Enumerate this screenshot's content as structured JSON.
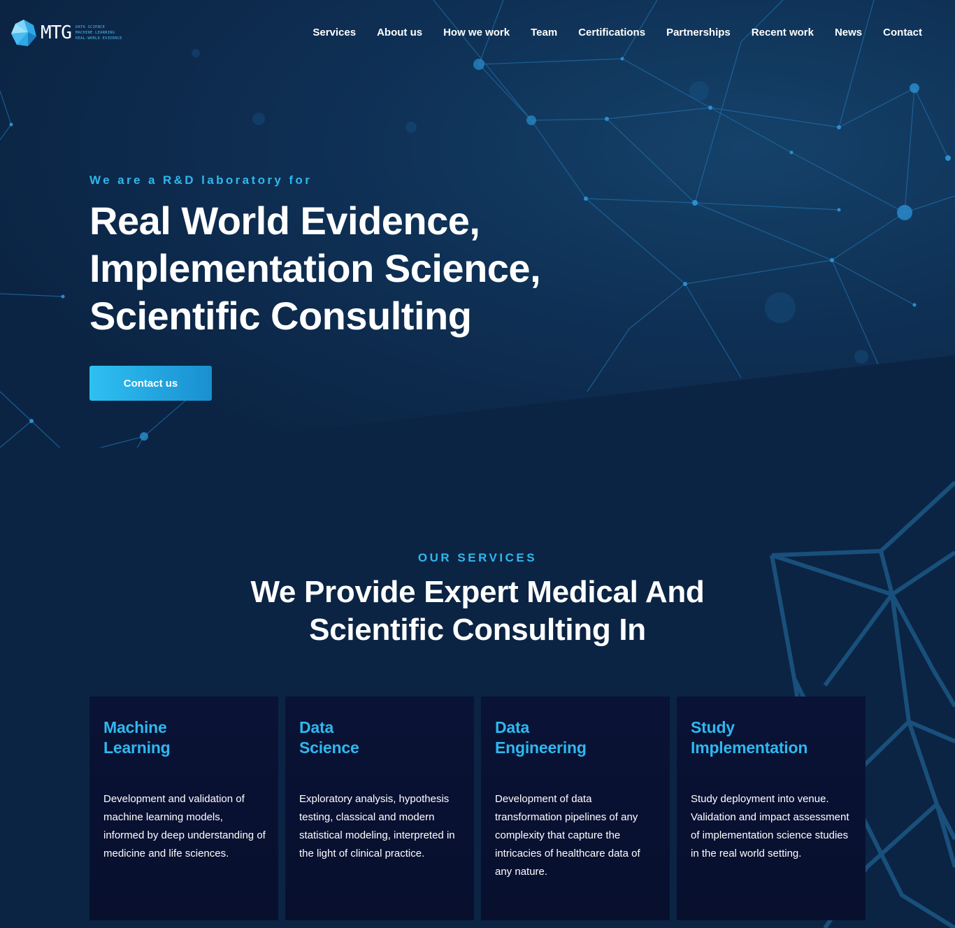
{
  "brand": {
    "name": "MTG",
    "tagline": [
      "DATA SCIENCE",
      "MACHINE LEARNING",
      "REAL-WORLD EVIDENCE"
    ]
  },
  "nav": {
    "items": [
      {
        "label": "Services"
      },
      {
        "label": "About us"
      },
      {
        "label": "How we work"
      },
      {
        "label": "Team"
      },
      {
        "label": "Certifications"
      },
      {
        "label": "Partnerships"
      },
      {
        "label": "Recent work"
      },
      {
        "label": "News"
      },
      {
        "label": "Contact"
      }
    ]
  },
  "hero": {
    "kicker": "We are a R&D laboratory for",
    "title_lines": [
      "Real World Evidence,",
      "Implementation Science,",
      "Scientific Consulting"
    ],
    "cta_label": "Contact us"
  },
  "services": {
    "kicker": "OUR SERVICES",
    "title_lines": [
      "We Provide Expert Medical And",
      "Scientific Consulting In"
    ],
    "cards": [
      {
        "title_lines": [
          "Machine",
          "Learning"
        ],
        "text": "Development and validation of machine learning models, informed by deep understanding of medicine and life sciences."
      },
      {
        "title_lines": [
          "Data",
          "Science"
        ],
        "text": "Exploratory analysis, hypothesis testing, classical and modern statistical modeling, interpreted in the light of clinical practice."
      },
      {
        "title_lines": [
          "Data",
          "Engineering"
        ],
        "text": "Development of data transformation pipelines of any complexity that capture the intricacies of healthcare data of any nature."
      },
      {
        "title_lines": [
          "Study",
          "Implementation"
        ],
        "text": "Study deployment into venue. Validation and impact assessment of implementation science studies in the real world setting."
      }
    ]
  },
  "colors": {
    "accent": "#2fb8ee",
    "background": "#0b2444",
    "card": "#0a1236"
  }
}
